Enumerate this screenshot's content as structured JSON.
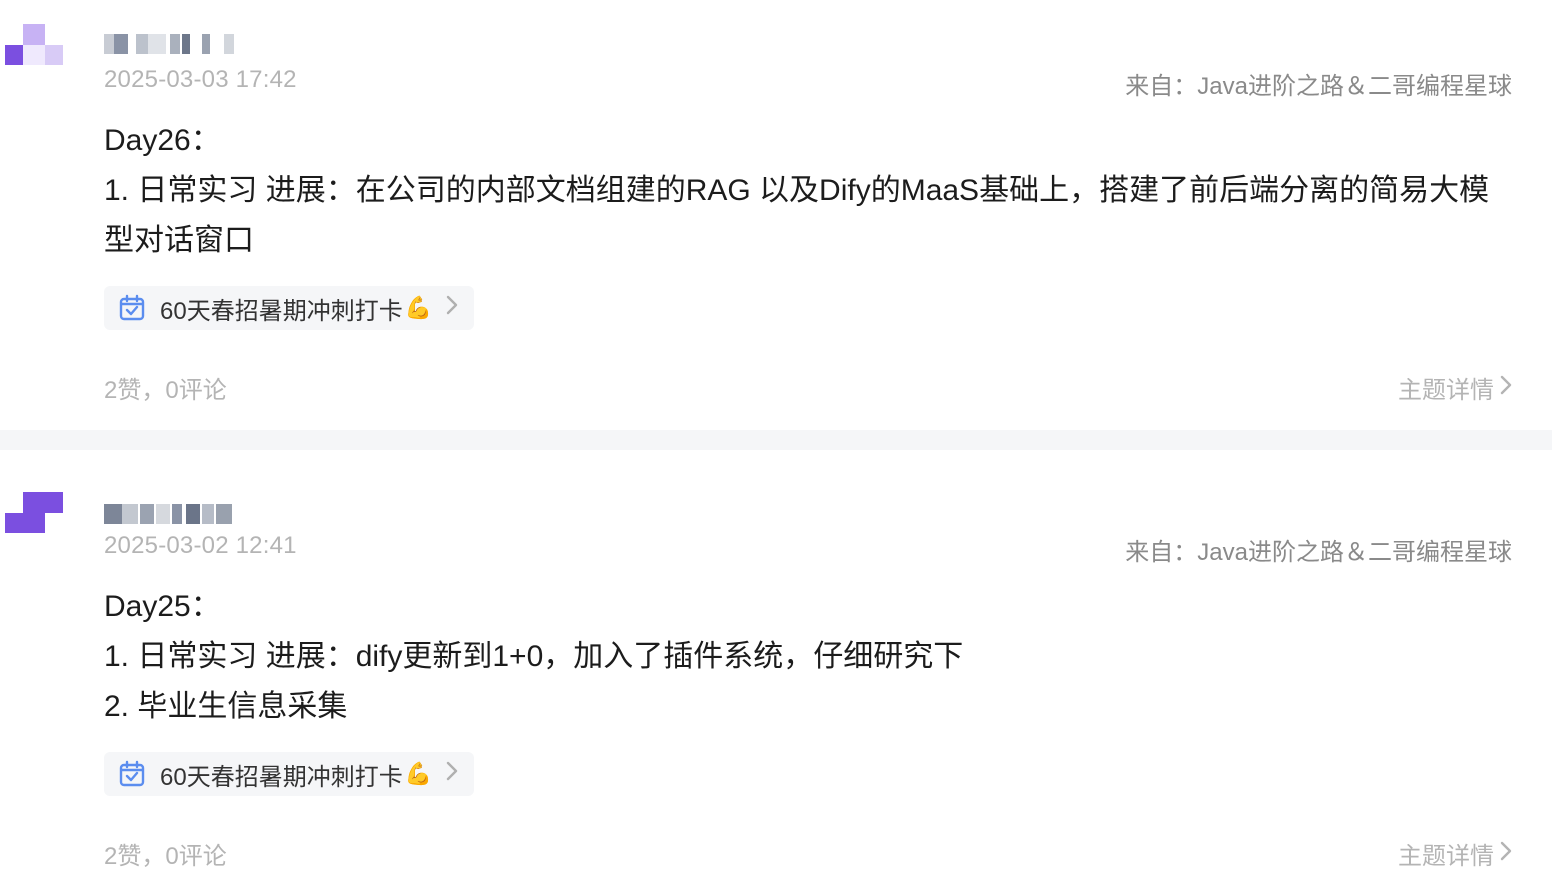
{
  "posts": [
    {
      "timestamp": "2025-03-03 17:42",
      "source": "来自：Java进阶之路＆二哥编程星球",
      "lines": [
        "Day26：",
        "1. 日常实习 进展：在公司的内部文档组建的RAG 以及Dify的MaaS基础上，搭建了前后端分离的简易大模型对话窗口"
      ],
      "tag": {
        "label": "60天春招暑期冲刺打卡",
        "emoji": "💪",
        "icon": "calendar-check-icon"
      },
      "stats": "2赞，0评论",
      "detail_label": "主题详情"
    },
    {
      "timestamp": "2025-03-02 12:41",
      "source": "来自：Java进阶之路＆二哥编程星球",
      "lines": [
        "Day25：",
        "1. 日常实习 进展：dify更新到1+0，加入了插件系统，仔细研究下",
        "2. 毕业生信息采集"
      ],
      "tag": {
        "label": "60天春招暑期冲刺打卡",
        "emoji": "💪",
        "icon": "calendar-check-icon"
      },
      "stats": "2赞，0评论",
      "detail_label": "主题详情"
    }
  ],
  "colors": {
    "accent": "#7b4fe0",
    "tag_icon": "#5b8def",
    "muted": "#b4b4b4"
  }
}
